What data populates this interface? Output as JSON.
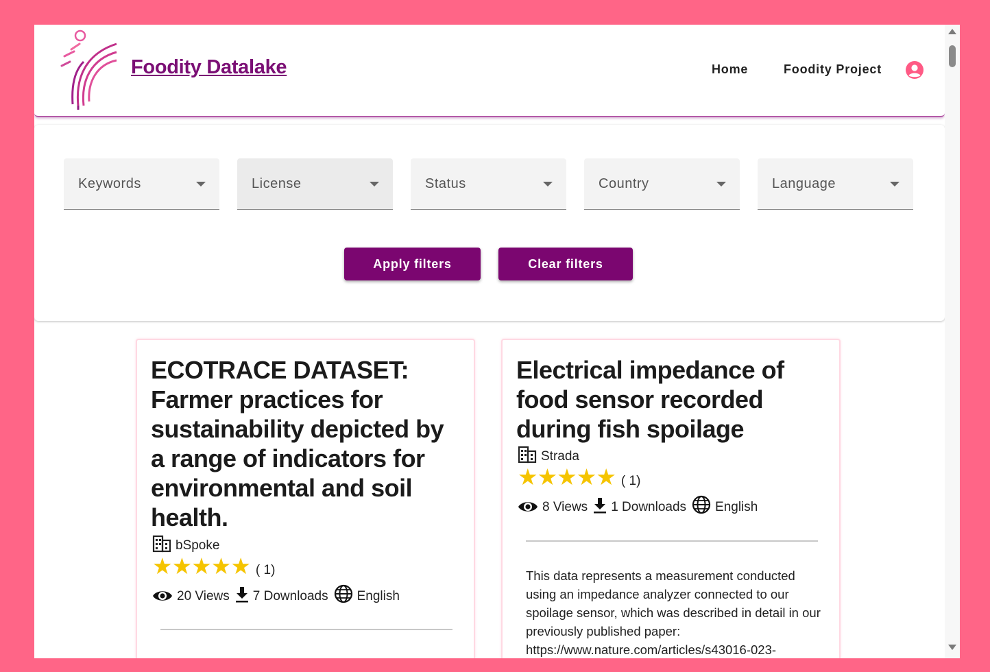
{
  "header": {
    "site_title": "Foodity Datalake",
    "nav": {
      "home": "Home",
      "project": "Foodity Project"
    },
    "brand_color": "#7b0670",
    "accent_color": "#ff6587"
  },
  "filters": {
    "dropdowns": {
      "keywords": "Keywords",
      "license": "License",
      "status": "Status",
      "country": "Country",
      "language": "Language"
    },
    "apply_label": "Apply filters",
    "clear_label": "Clear filters"
  },
  "datasets": [
    {
      "title": "ECOTRACE DATASET: Farmer practices for sustainability depicted by a range of indicators for environmental and soil health.",
      "organization": "bSpoke",
      "stars": "★★★★★",
      "rating": 5,
      "rating_count": "( 1)",
      "views": "20 Views",
      "downloads": "7 Downloads",
      "language": "English",
      "description": ""
    },
    {
      "title": "Electrical impedance of food sensor recorded during fish spoilage",
      "organization": "Strada",
      "stars": "★★★★★",
      "rating": 5,
      "rating_count": "( 1)",
      "views": "8 Views",
      "downloads": "1 Downloads",
      "language": "English",
      "description": "This data represents a measurement conducted using an impedance analyzer connected to our spoilage sensor, which was described in detail in our previously published paper: https://www.nature.com/articles/s43016-023-"
    }
  ],
  "icons": {
    "logo": "foodity-logo-icon",
    "user": "user-account-icon",
    "organization": "building-icon",
    "views": "eye-icon",
    "downloads": "download-icon",
    "language": "globe-icon"
  }
}
